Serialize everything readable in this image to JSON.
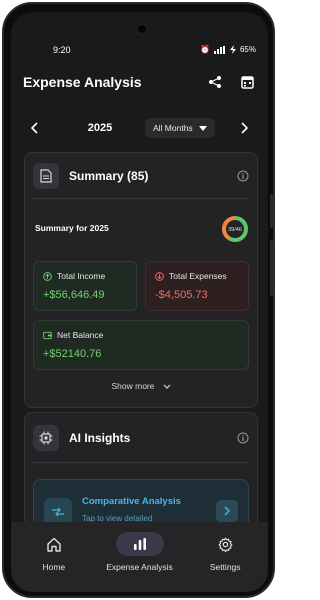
{
  "status": {
    "time": "9:20",
    "battery": "65%"
  },
  "header": {
    "title": "Expense Analysis",
    "share_icon": "share-icon",
    "calendar_icon": "calendar-icon"
  },
  "period": {
    "year": "2025",
    "month_filter": "All Months"
  },
  "summary": {
    "title": "Summary (85)",
    "subtitle": "Summary for 2025",
    "donut_label": "39/46",
    "income_label": "Total Income",
    "income_value": "+$56,646.49",
    "expense_label": "Total Expenses",
    "expense_value": "-$4,505.73",
    "balance_label": "Net Balance",
    "balance_value": "+$52140.76",
    "show_more": "Show more"
  },
  "ai": {
    "title": "AI Insights",
    "card_title": "Comparative Analysis",
    "card_subtitle": "Tap to view detailed comparison"
  },
  "nav": {
    "items": [
      {
        "label": "Home",
        "icon": "home-icon"
      },
      {
        "label": "Expense Analysis",
        "icon": "chart-icon"
      },
      {
        "label": "Settings",
        "icon": "gear-icon"
      }
    ]
  },
  "colors": {
    "income": "#6fd36f",
    "expense": "#f26b6b",
    "accent": "#4fb2e6"
  }
}
